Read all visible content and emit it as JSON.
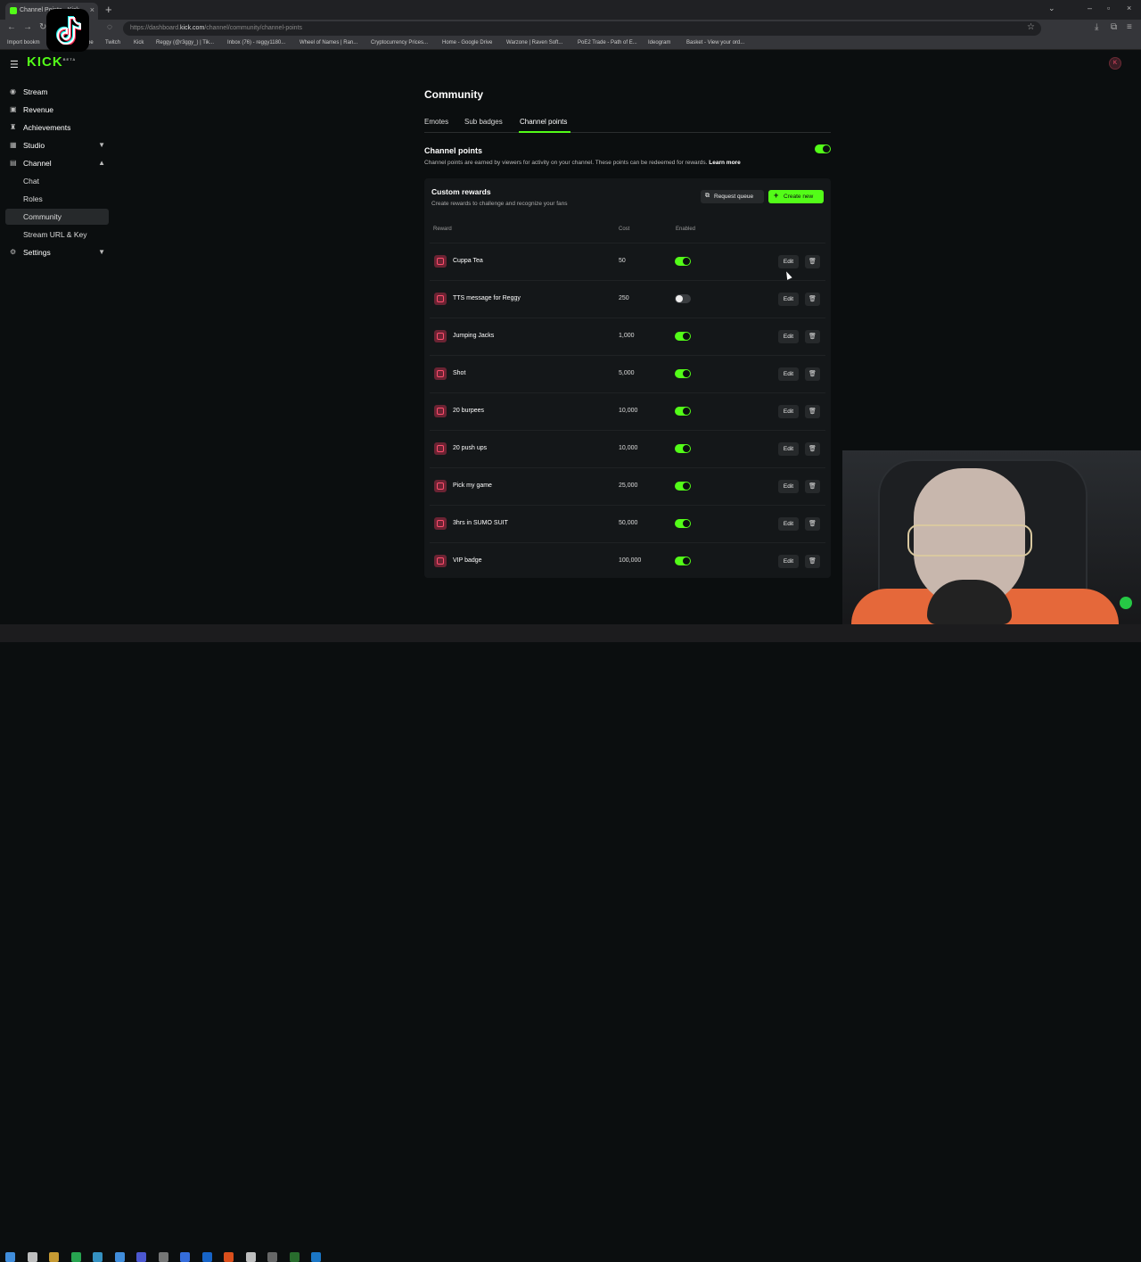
{
  "browser": {
    "tab_title": "Channel Points - Kick",
    "url_prefix": "https://dashboard.",
    "url_domain": "kick.com",
    "url_path": "/channel/community/channel-points",
    "bookmarks": [
      "Import bookm",
      "be",
      "Twitch",
      "Kick",
      "Reggy (@r3ggy_) | Tik...",
      "Inbox (76) - reggy1180...",
      "Wheel of Names | Ran...",
      "Cryptocurrency Prices...",
      "Home - Google Drive",
      "Warzone | Raven Soft...",
      "PoE2 Trade - Path of E...",
      "Ideogram",
      "Basket - View your ord..."
    ]
  },
  "header": {
    "logo": "KICK",
    "logo_sup": "BETA",
    "avatar": "K"
  },
  "sidebar": {
    "items": [
      {
        "label": "Stream"
      },
      {
        "label": "Revenue"
      },
      {
        "label": "Achievements"
      },
      {
        "label": "Studio"
      },
      {
        "label": "Channel"
      },
      {
        "label": "Chat"
      },
      {
        "label": "Roles"
      },
      {
        "label": "Community"
      },
      {
        "label": "Stream URL & Key"
      },
      {
        "label": "Settings"
      }
    ]
  },
  "main": {
    "title": "Community",
    "tabs": [
      {
        "label": "Emotes"
      },
      {
        "label": "Sub badges"
      },
      {
        "label": "Channel points"
      }
    ],
    "channel_points": {
      "title": "Channel points",
      "description": "Channel points are earned by viewers for activity on your channel. These points can be redeemed for rewards.",
      "learn_more": "Learn more",
      "enabled": true
    },
    "custom_rewards": {
      "title": "Custom rewards",
      "description": "Create rewards to challenge and recognize your fans",
      "request_queue": "Request queue",
      "create_new": "Create new",
      "columns": {
        "reward": "Reward",
        "cost": "Cost",
        "enabled": "Enabled"
      },
      "edit_label": "Edit",
      "rows": [
        {
          "name": "Cuppa Tea",
          "cost": "50",
          "enabled": true
        },
        {
          "name": "TTS message for Reggy",
          "cost": "250",
          "enabled": false
        },
        {
          "name": "Jumping Jacks",
          "cost": "1,000",
          "enabled": true
        },
        {
          "name": "Shot",
          "cost": "5,000",
          "enabled": true
        },
        {
          "name": "20 burpees",
          "cost": "10,000",
          "enabled": true
        },
        {
          "name": "20 push ups",
          "cost": "10,000",
          "enabled": true
        },
        {
          "name": "Pick my game",
          "cost": "25,000",
          "enabled": true
        },
        {
          "name": "3hrs in SUMO SUIT",
          "cost": "50,000",
          "enabled": true
        },
        {
          "name": "VIP badge",
          "cost": "100,000",
          "enabled": true
        }
      ]
    }
  },
  "colors": {
    "accent": "#53fc18",
    "background": "#0b0e0f",
    "panel": "#141719"
  }
}
